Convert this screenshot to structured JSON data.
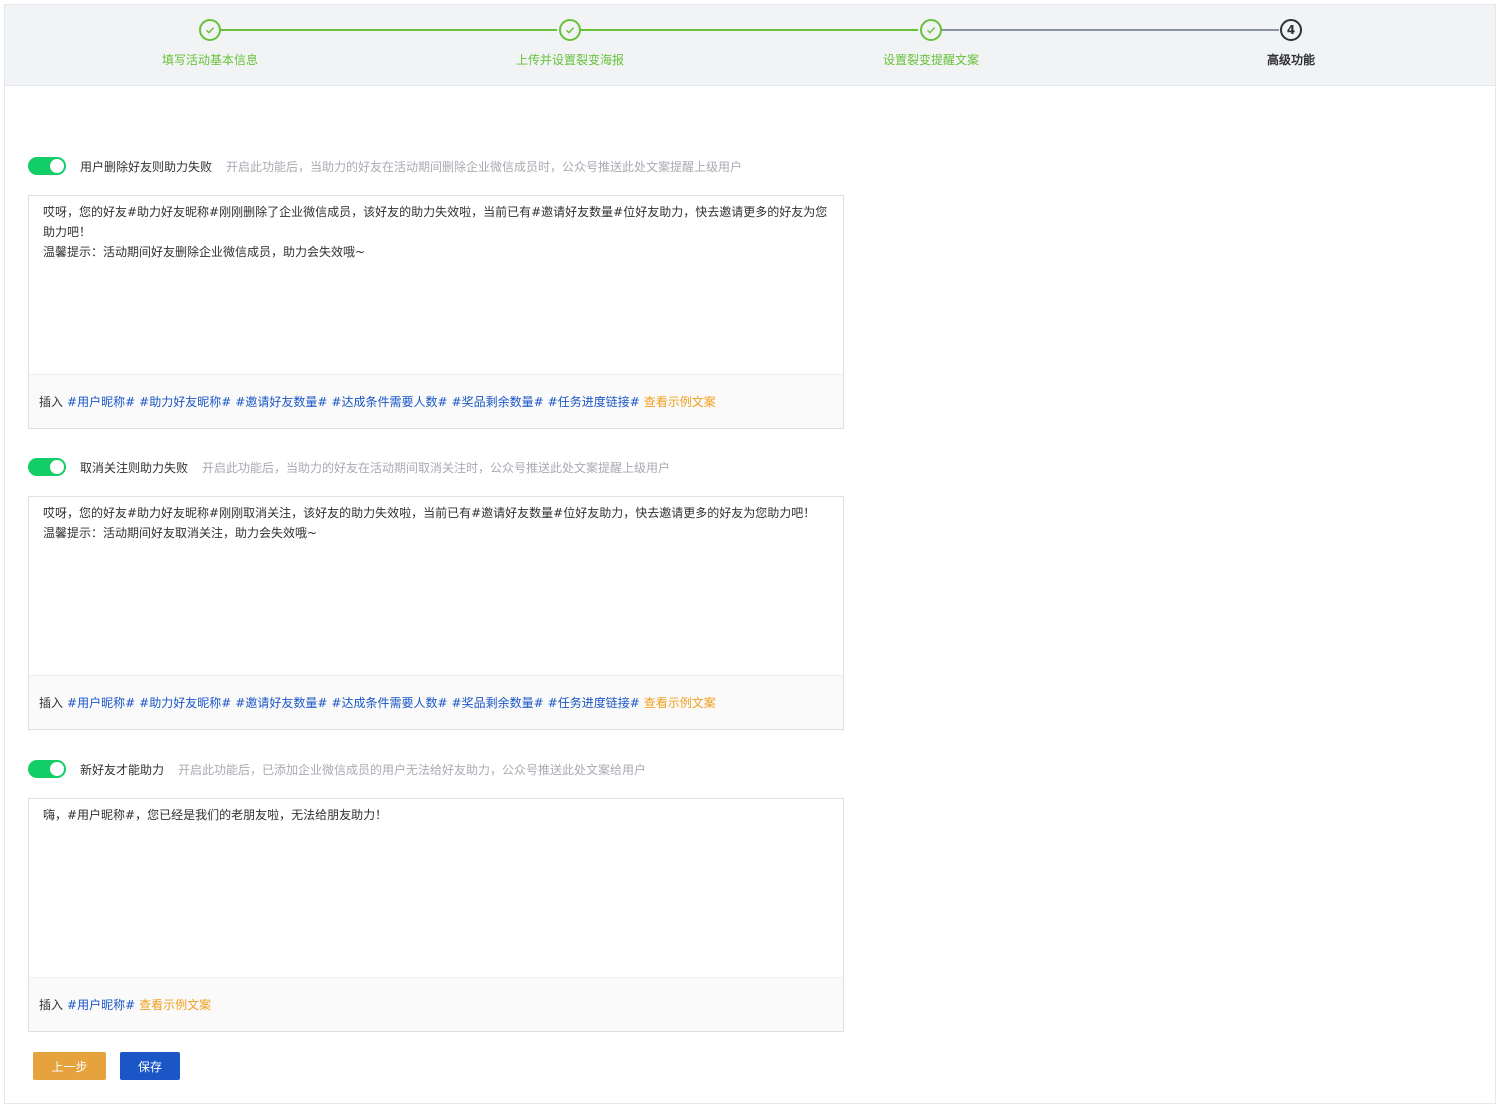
{
  "steps": [
    {
      "title": "填写活动基本信息",
      "status": "done"
    },
    {
      "title": "上传并设置裂变海报",
      "status": "done"
    },
    {
      "title": "设置裂变提醒文案",
      "status": "done"
    },
    {
      "title": "高级功能",
      "status": "current",
      "number": "4"
    }
  ],
  "sections": [
    {
      "enabled": true,
      "label": "用户删除好友则助力失败",
      "hint": "开启此功能后，当助力的好友在活动期间删除企业微信成员时，公众号推送此处文案提醒上级用户",
      "text": "哎呀，您的好友#助力好友昵称#刚刚删除了企业微信成员，该好友的助力失效啦，当前已有#邀请好友数量#位好友助力，快去邀请更多的好友为您助力吧！\n温馨提示：活动期间好友删除企业微信成员，助力会失效哦~",
      "insert_label": "插入",
      "tags": [
        "#用户昵称#",
        "#助力好友昵称#",
        "#邀请好友数量#",
        "#达成条件需要人数#",
        "#奖品剩余数量#",
        "#任务进度链接#"
      ],
      "example_link": "查看示例文案"
    },
    {
      "enabled": true,
      "label": "取消关注则助力失败",
      "hint": "开启此功能后，当助力的好友在活动期间取消关注时，公众号推送此处文案提醒上级用户",
      "text": "哎呀，您的好友#助力好友昵称#刚刚取消关注，该好友的助力失效啦，当前已有#邀请好友数量#位好友助力，快去邀请更多的好友为您助力吧！\n温馨提示：活动期间好友取消关注，助力会失效哦~",
      "insert_label": "插入",
      "tags": [
        "#用户昵称#",
        "#助力好友昵称#",
        "#邀请好友数量#",
        "#达成条件需要人数#",
        "#奖品剩余数量#",
        "#任务进度链接#"
      ],
      "example_link": "查看示例文案"
    },
    {
      "enabled": true,
      "label": "新好友才能助力",
      "hint": "开启此功能后，已添加企业微信成员的用户无法给好友助力，公众号推送此处文案给用户",
      "text": "嗨，#用户昵称#，您已经是我们的老朋友啦，无法给朋友助力！",
      "insert_label": "插入",
      "tags": [
        "#用户昵称#"
      ],
      "example_link": "查看示例文案"
    }
  ],
  "buttons": {
    "prev": "上一步",
    "save": "保存"
  },
  "colors": {
    "done": "#67c23a",
    "switch_on": "#13ce66",
    "tag": "#1a56c6",
    "example": "#f0a020",
    "prev_button": "#e6a23c",
    "save_button": "#1a56c6"
  }
}
